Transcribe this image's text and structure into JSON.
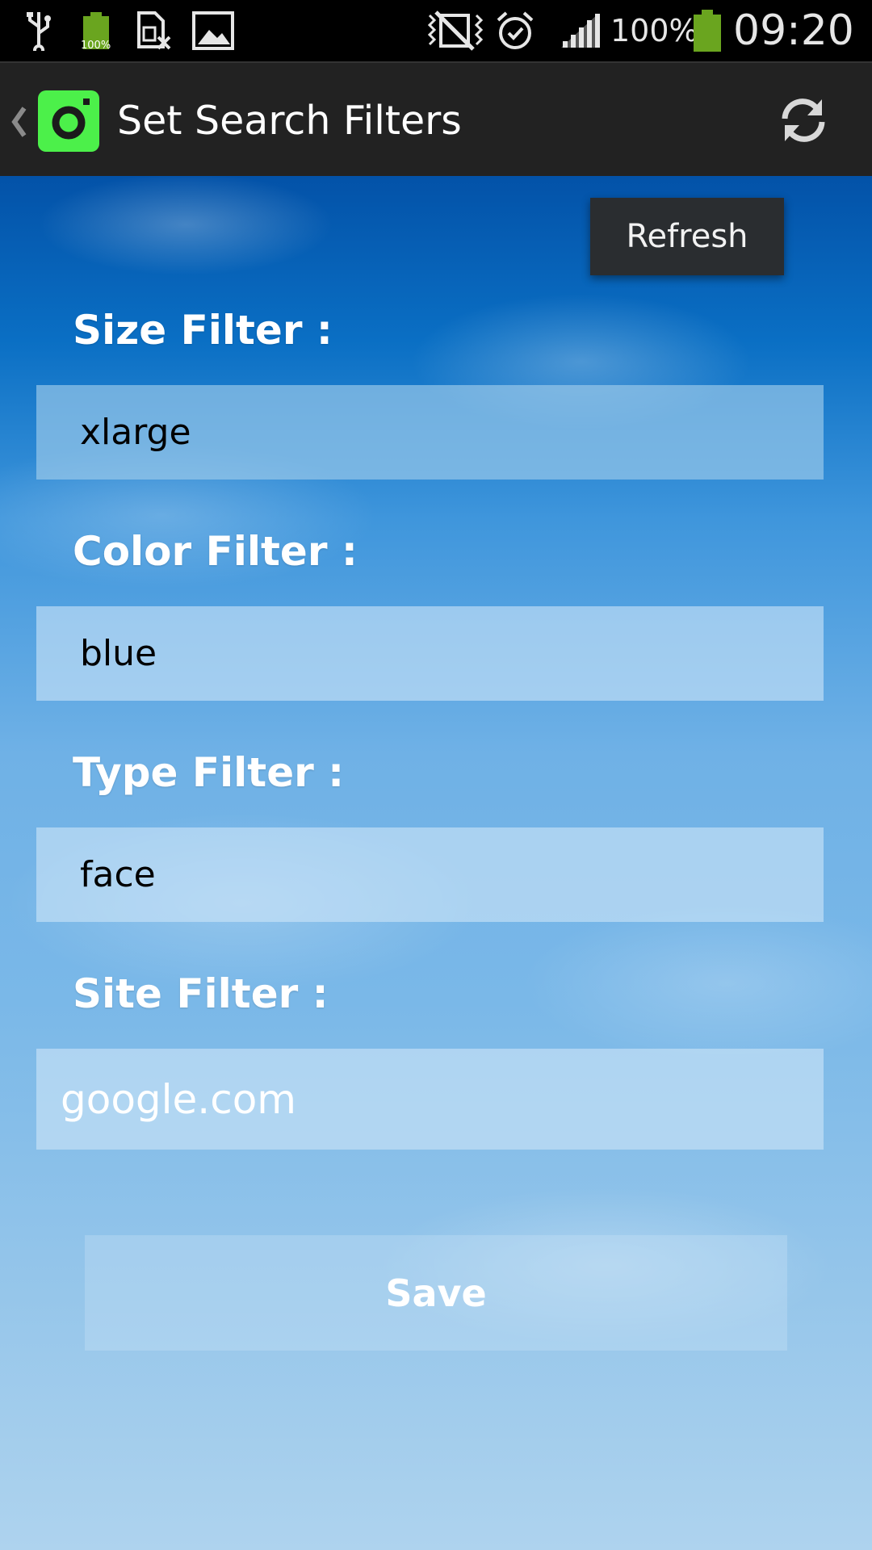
{
  "status_bar": {
    "battery_percent": "100%",
    "small_battery_label": "100%",
    "time": "09:20",
    "icons": [
      "usb-icon",
      "battery-small-icon",
      "sim-icon",
      "image-icon",
      "mute-icon",
      "alarm-icon",
      "signal-icon",
      "battery-icon"
    ],
    "battery_color": "#6aa51f"
  },
  "action_bar": {
    "title": "Set Search Filters",
    "app_icon_color": "#4cf04a",
    "refresh_icon": "refresh-icon"
  },
  "popup_menu": {
    "items": [
      {
        "label": "Refresh"
      }
    ]
  },
  "form": {
    "size": {
      "label": "Size Filter :",
      "value": "xlarge"
    },
    "color": {
      "label": "Color Filter :",
      "value": "blue"
    },
    "type": {
      "label": "Type Filter :",
      "value": "face"
    },
    "site": {
      "label": "Site Filter :",
      "value": "",
      "placeholder": "google.com"
    },
    "save_label": "Save"
  }
}
